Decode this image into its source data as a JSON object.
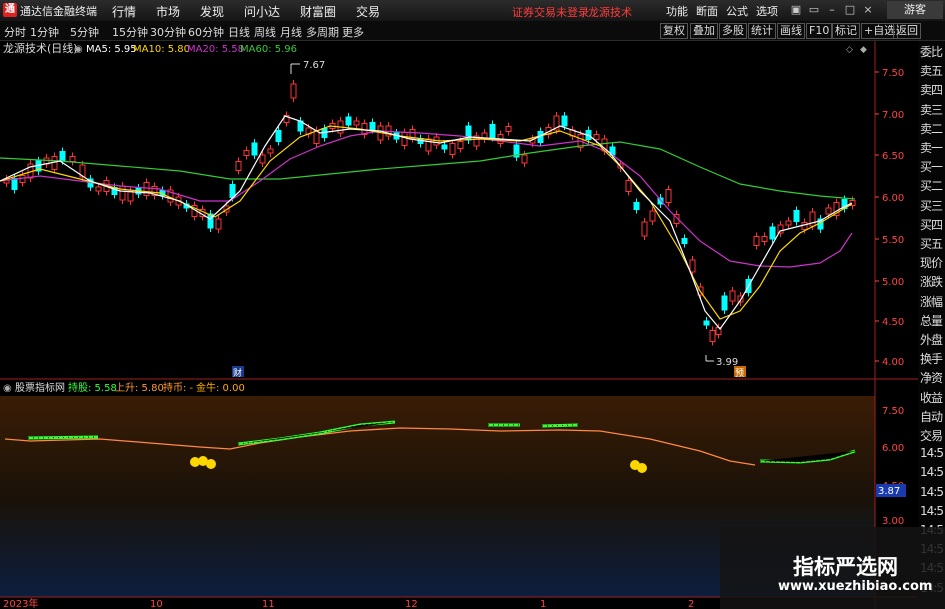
{
  "menubar": {
    "app_title": "通达信金融终端",
    "menus": [
      "行情",
      "市场",
      "发现",
      "问小达",
      "财富圈",
      "交易"
    ],
    "notice": "证券交易未登录",
    "brand": "龙源技术",
    "right_menus": [
      "功能",
      "断面",
      "公式",
      "选项"
    ],
    "guest": "游客"
  },
  "toolbar": {
    "periods": [
      "分时",
      "1分钟",
      "5分钟",
      "15分钟",
      "30分钟",
      "60分钟",
      "日线",
      "周线",
      "月线",
      "多周期",
      "更多"
    ],
    "buttons": [
      "复权",
      "叠加",
      "多股",
      "统计",
      "画线",
      "F10",
      "标记",
      "+自选",
      "返回"
    ]
  },
  "main_chart": {
    "title": "龙源技术(日线)",
    "ma": [
      {
        "label": "MA5: 5.95",
        "color": "#ffffff"
      },
      {
        "label": "MA10: 5.80",
        "color": "#ffd700"
      },
      {
        "label": "MA20: 5.58",
        "color": "#cc33cc"
      },
      {
        "label": "MA60: 5.96",
        "color": "#33cc33"
      }
    ],
    "high_label": "7.67",
    "low_label": "3.99",
    "event_markers": [
      "财",
      "预"
    ],
    "price_ticks": [
      "7.50",
      "7.00",
      "6.50",
      "6.00",
      "5.50",
      "5.00",
      "4.50",
      "4.00"
    ]
  },
  "sub_chart": {
    "title": "股票指标网",
    "items": [
      {
        "label": "持股: 5.58",
        "color": "#33ff33"
      },
      {
        "label": "上升: 5.80",
        "color": "#ff9933"
      },
      {
        "label": "持币: -",
        "color": "#ff9933"
      },
      {
        "label": "金牛: 0.00",
        "color": "#ffaa00"
      }
    ],
    "ticks": [
      "7.50",
      "6.00",
      "4.50",
      "3.00"
    ],
    "current_value": "3.87"
  },
  "date_axis": [
    "2023年",
    "10",
    "11",
    "12",
    "1",
    "2"
  ],
  "side_panel": {
    "items": [
      "委比",
      "卖五",
      "卖四",
      "卖三",
      "卖二",
      "卖一",
      "买一",
      "买二",
      "买三",
      "买四",
      "买五",
      "现价",
      "涨跌",
      "涨幅",
      "总量",
      "外盘",
      "换手",
      "净资",
      "收益",
      "自动",
      "交易",
      "14:5",
      "14:5",
      "14:5",
      "14:5",
      "14:5",
      "14:5",
      "14:5",
      "14:5"
    ]
  },
  "watermark": {
    "title": "指标严选网",
    "url": "www.xuezhibiao.com"
  },
  "colors": {
    "up": "#ff3333",
    "down": "#00ffff",
    "ma5": "#ffffff",
    "ma10": "#ffd700",
    "ma20": "#cc33cc",
    "ma60": "#33cc33",
    "hold_line": "#33ff33",
    "cash_line": "#ff8844"
  }
}
